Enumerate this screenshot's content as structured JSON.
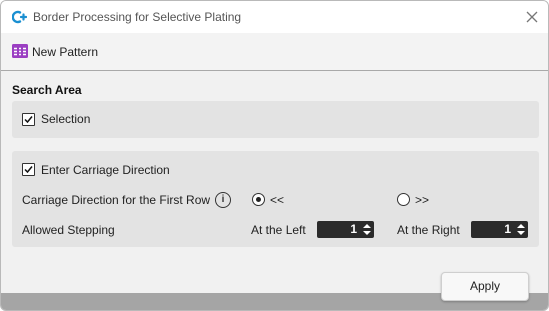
{
  "window": {
    "title": "Border Processing for Selective Plating"
  },
  "toolbar": {
    "new_pattern_label": "New Pattern"
  },
  "search_area": {
    "title": "Search Area",
    "selection": {
      "label": "Selection",
      "checked": true
    }
  },
  "carriage": {
    "enter_label": "Enter Carriage Direction",
    "enter_checked": true,
    "first_row_label": "Carriage Direction for the First Row",
    "options": [
      {
        "label": "<<",
        "selected": true
      },
      {
        "label": ">>",
        "selected": false
      }
    ],
    "allowed_stepping_label": "Allowed Stepping",
    "at_left_label": "At the Left",
    "at_left_value": "1",
    "at_right_label": "At the Right",
    "at_right_value": "1"
  },
  "footer": {
    "apply_label": "Apply"
  },
  "icons": {
    "app": "app-logo-icon",
    "close": "close-icon",
    "new_pattern": "grid-pattern-icon",
    "info": "info-icon",
    "spinner": "spinner-arrows-icon"
  },
  "colors": {
    "app_icon": "#1a8fd1",
    "new_pattern_icon": "#9b3fc2",
    "spinner_bg": "#2b2b2b",
    "panel_bg": "#e3e3e3"
  }
}
